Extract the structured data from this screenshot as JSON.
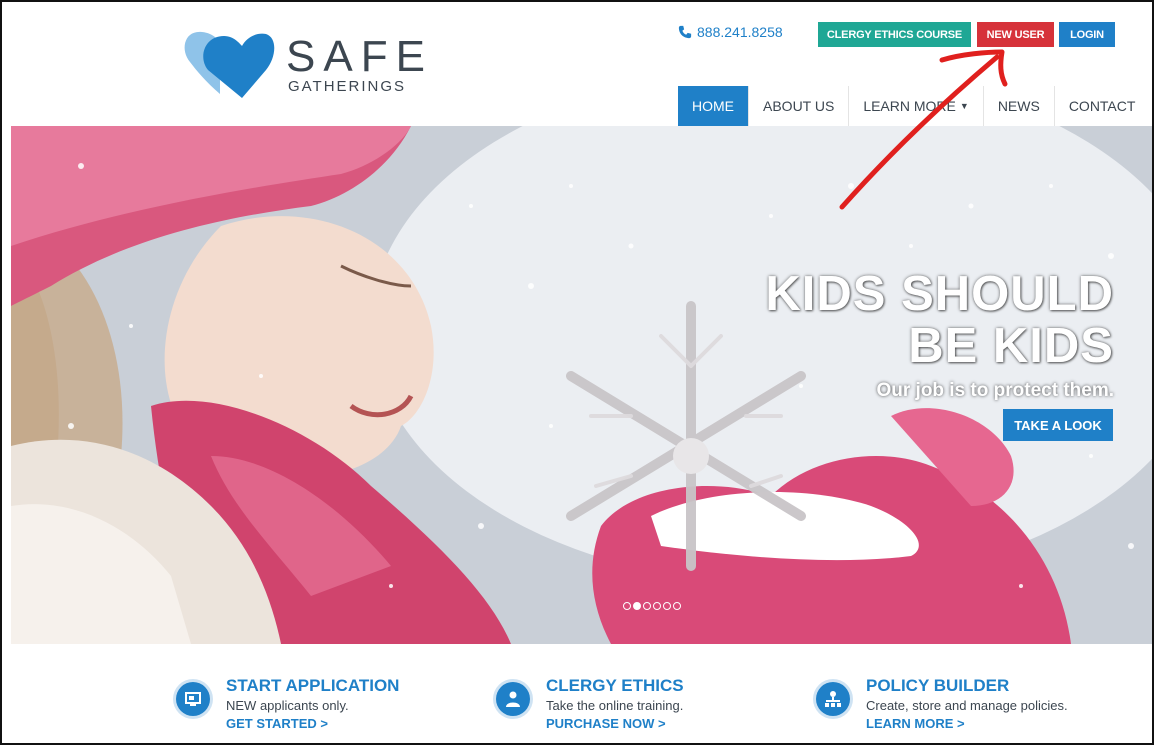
{
  "brand": {
    "name_main": "SAFE",
    "name_sub": "GATHERINGS",
    "colors": {
      "primary": "#1f80c8",
      "light": "#8fc3e9",
      "text": "#3c4650"
    }
  },
  "header": {
    "phone": "888.241.8258",
    "buttons": {
      "clergy": {
        "label": "CLERGY ETHICS COURSE",
        "color": "#1fa795"
      },
      "new_user": {
        "label": "NEW USER",
        "color": "#d6323a"
      },
      "login": {
        "label": "LOGIN",
        "color": "#1f80c8"
      }
    },
    "nav": [
      {
        "label": "HOME",
        "active": true
      },
      {
        "label": "ABOUT US",
        "active": false
      },
      {
        "label": "LEARN MORE",
        "active": false
      },
      {
        "label": "NEWS",
        "active": false
      },
      {
        "label": "CONTACT",
        "active": false
      }
    ]
  },
  "hero": {
    "title_line1": "KIDS SHOULD",
    "title_line2": "BE KIDS",
    "subtitle": "Our job is to protect them.",
    "cta": "TAKE A LOOK",
    "slide_count": 6,
    "active_slide": 2
  },
  "features": [
    {
      "title": "START APPLICATION",
      "desc": "NEW applicants only.",
      "link": "GET STARTED >",
      "icon": "monitor-icon"
    },
    {
      "title": "CLERGY ETHICS",
      "desc": "Take the online training.",
      "link": "PURCHASE NOW >",
      "icon": "person-icon"
    },
    {
      "title": "POLICY BUILDER",
      "desc": "Create, store and manage policies.",
      "link": "LEARN MORE >",
      "icon": "org-chart-icon"
    }
  ],
  "annotation": {
    "icon": "red-arrow-pointing-to-new-user",
    "color": "#e0201e"
  }
}
